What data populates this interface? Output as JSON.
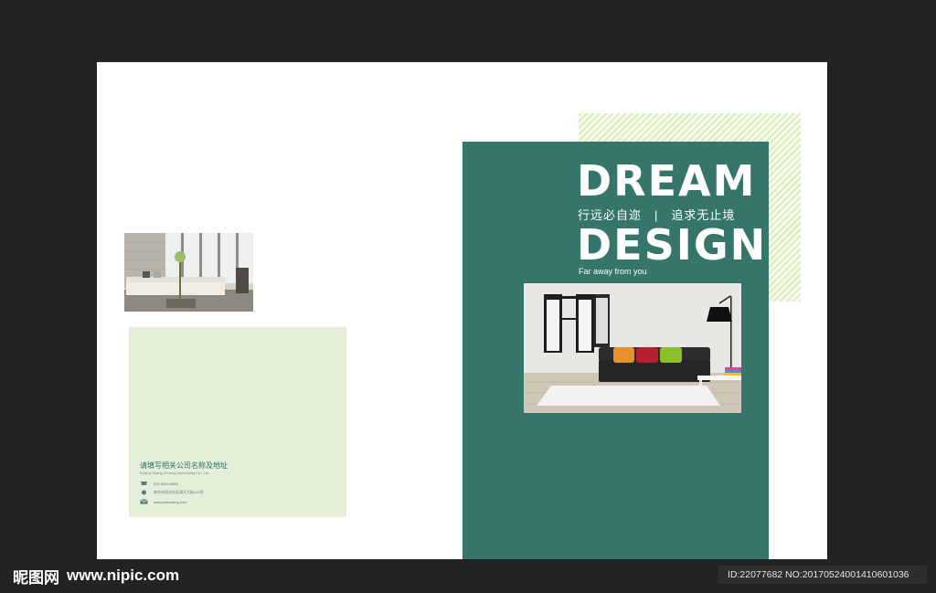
{
  "cover": {
    "title_line1": "DREAM",
    "tagline": "行远必自迩　|　追求无止境",
    "title_line2": "DESIGN",
    "subtitle": "Far away from you"
  },
  "back": {
    "company_name": "请填写相关公司名称及地址",
    "company_en": "Beijing Shang Zhuang Advertising Co., Ltd.",
    "phone": "025 5345 8888",
    "address": "南京市阳光社区满天大街120号",
    "website": "www.pintuwang.com"
  },
  "watermark": {
    "brand": "昵图网",
    "url": "www.nipic.com",
    "id_text": "ID:22077682 NO:20170524001410601036"
  },
  "colors": {
    "cover_green": "#36766a",
    "hatch_green": "#d8ecb9",
    "card_green": "#e3efd9"
  },
  "icons": [
    "phone-icon",
    "location-icon",
    "mail-icon"
  ]
}
